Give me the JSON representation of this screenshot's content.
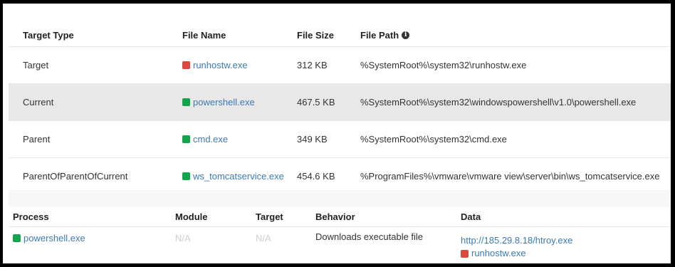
{
  "files_table": {
    "headers": {
      "target_type": "Target Type",
      "file_name": "File Name",
      "file_size": "File Size",
      "file_path": "File Path"
    },
    "rows": [
      {
        "target_type": "Target",
        "file_name": "runhostw.exe",
        "status": "red",
        "file_size": "312 KB",
        "file_path": "%SystemRoot%\\system32\\runhostw.exe"
      },
      {
        "target_type": "Current",
        "file_name": "powershell.exe",
        "status": "green",
        "file_size": "467.5 KB",
        "file_path": "%SystemRoot%\\system32\\windowspowershell\\v1.0\\powershell.exe"
      },
      {
        "target_type": "Parent",
        "file_name": "cmd.exe",
        "status": "green",
        "file_size": "349 KB",
        "file_path": "%SystemRoot%\\system32\\cmd.exe"
      },
      {
        "target_type": "ParentOfParentOfCurrent",
        "file_name": "ws_tomcatservice.exe",
        "status": "green",
        "file_size": "454.6 KB",
        "file_path": "%ProgramFiles%\\vmware\\vmware view\\server\\bin\\ws_tomcatservice.exe"
      }
    ]
  },
  "behavior_table": {
    "headers": {
      "process": "Process",
      "module": "Module",
      "target": "Target",
      "behavior": "Behavior",
      "data": "Data"
    },
    "rows": [
      {
        "process": "powershell.exe",
        "module": "N/A",
        "target": "N/A",
        "behavior": "Downloads executable file",
        "data_url": "http://185.29.8.18/htroy.exe",
        "data_file": "runhostw.exe"
      }
    ]
  },
  "colors": {
    "red": "#d94a3d",
    "green": "#13a54b",
    "link": "#3a7bb3"
  },
  "icons": {
    "info": "info-circle-icon",
    "status": "status-square-icon"
  }
}
